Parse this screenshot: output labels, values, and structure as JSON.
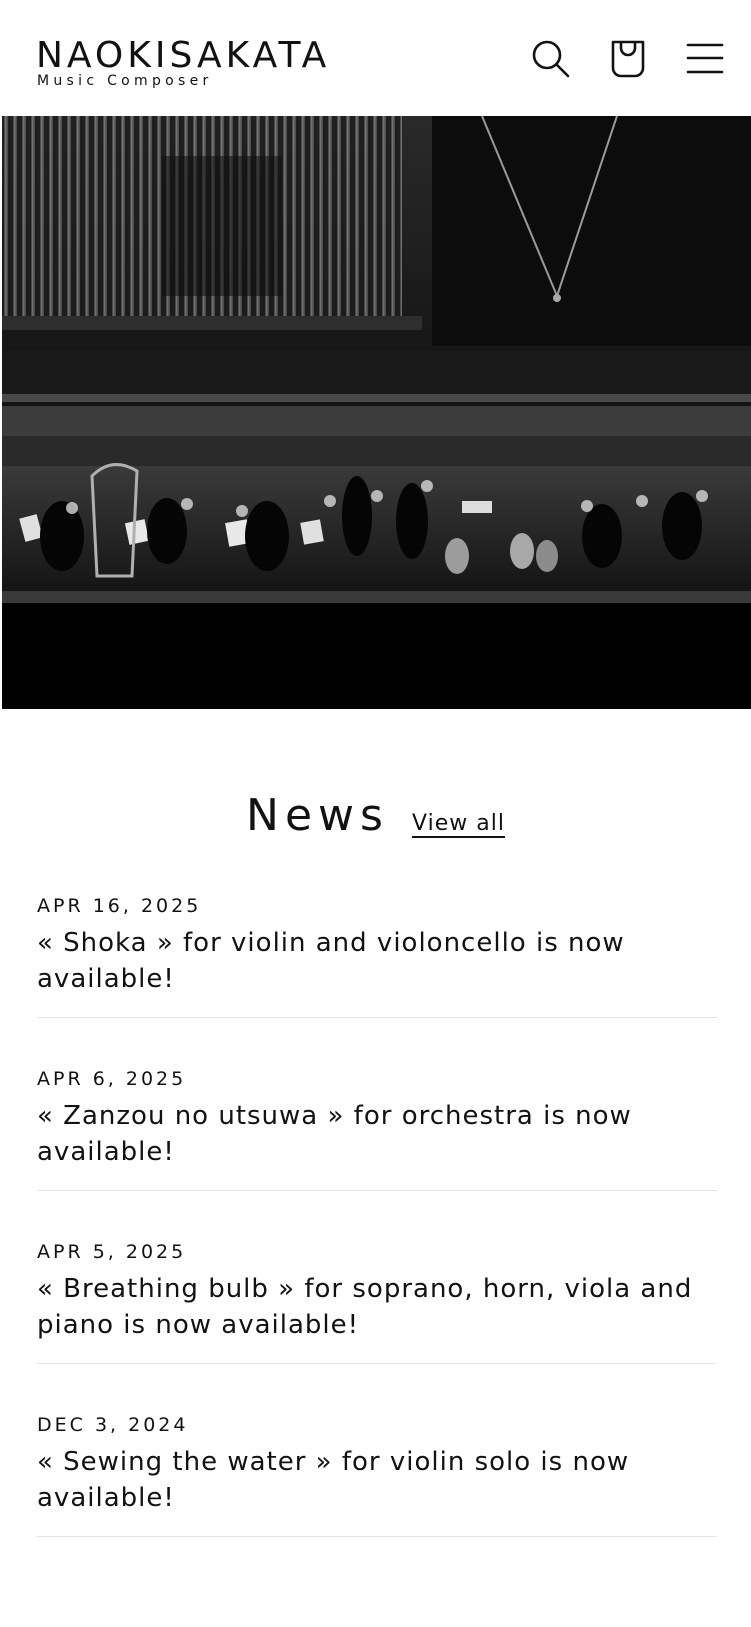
{
  "header": {
    "brand_name": "NAOKISAKATA",
    "brand_tagline": "Music Composer",
    "icons": [
      "search-icon",
      "cart-icon",
      "menu-icon"
    ]
  },
  "hero": {
    "image_subject": "orchestra-concert-photo"
  },
  "news": {
    "title": "News",
    "view_all_label": "View all",
    "items": [
      {
        "date": "APR 16, 2025",
        "text": "« Shoka » for violin and violoncello is now available!"
      },
      {
        "date": "APR 6, 2025",
        "text": "« Zanzou no utsuwa » for orchestra is now available!"
      },
      {
        "date": "APR 5, 2025",
        "text": "« Breathing bulb » for soprano, horn, viola and piano is now available!"
      },
      {
        "date": "DEC 3, 2024",
        "text": "« Sewing the water » for violin solo is now available!"
      }
    ]
  },
  "colors": {
    "text": "#121212",
    "background": "#ffffff",
    "divider": "#e4e4e4",
    "hero_dark": "#050505"
  }
}
